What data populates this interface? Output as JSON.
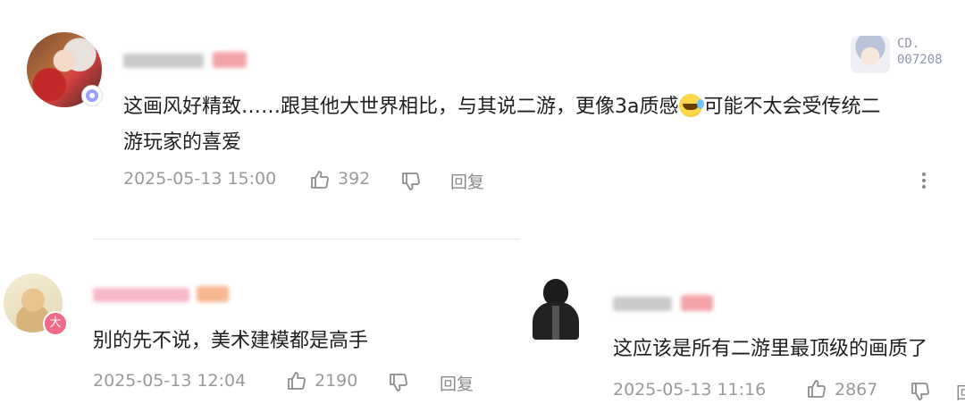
{
  "comments": [
    {
      "text_line1": "这画风好精致……跟其他大世界相比，与其说二游，更像3a质感",
      "text_line1_after_emoji": "可能不太会受传统二",
      "text_line2": "游玩家的喜爱",
      "time": "2025-05-13 15:00",
      "likes": "392",
      "reply_label": "回复"
    },
    {
      "text": "别的先不说，美术建模都是高手",
      "badge": "大",
      "time": "2025-05-13 12:04",
      "likes": "2190",
      "reply_label": "回复"
    },
    {
      "text": "这应该是所有二游里最顶级的画质了",
      "time": "2025-05-13 11:16",
      "likes": "2867"
    }
  ],
  "sticker": {
    "line1": "CD.",
    "line2": "007208"
  },
  "icons": {
    "like": "thumbs-up-icon",
    "dislike": "thumbs-down-icon",
    "more": "more-vertical-icon",
    "emoji": "laughing-emoji-icon"
  },
  "colors": {
    "meta_text": "#9a9a9a",
    "body_text": "#1f1f1f",
    "divider": "#e6e6e6",
    "name_pink": "#f4a0b8",
    "name_orange": "#f5b08a"
  }
}
